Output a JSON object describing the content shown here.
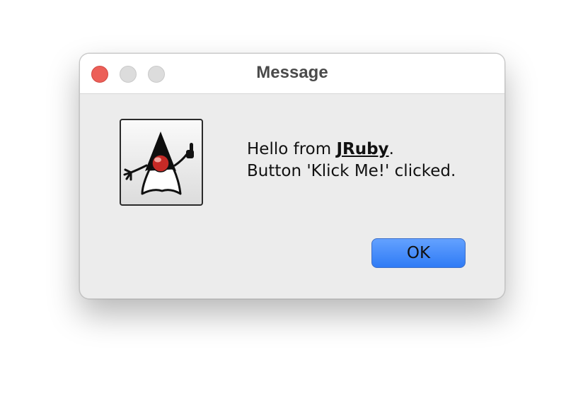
{
  "window": {
    "title": "Message"
  },
  "message": {
    "prefix": "Hello from ",
    "link_text": "JRuby",
    "suffix": ".",
    "line2": "Button 'Klick Me!' clicked."
  },
  "buttons": {
    "ok_label": "OK"
  },
  "icon": {
    "name": "java-duke-icon"
  },
  "colors": {
    "close": "#ec5f58",
    "inactive_traffic": "#dcdcdc",
    "ok_button": "#2f7bf5",
    "window_bg": "#ececec"
  }
}
